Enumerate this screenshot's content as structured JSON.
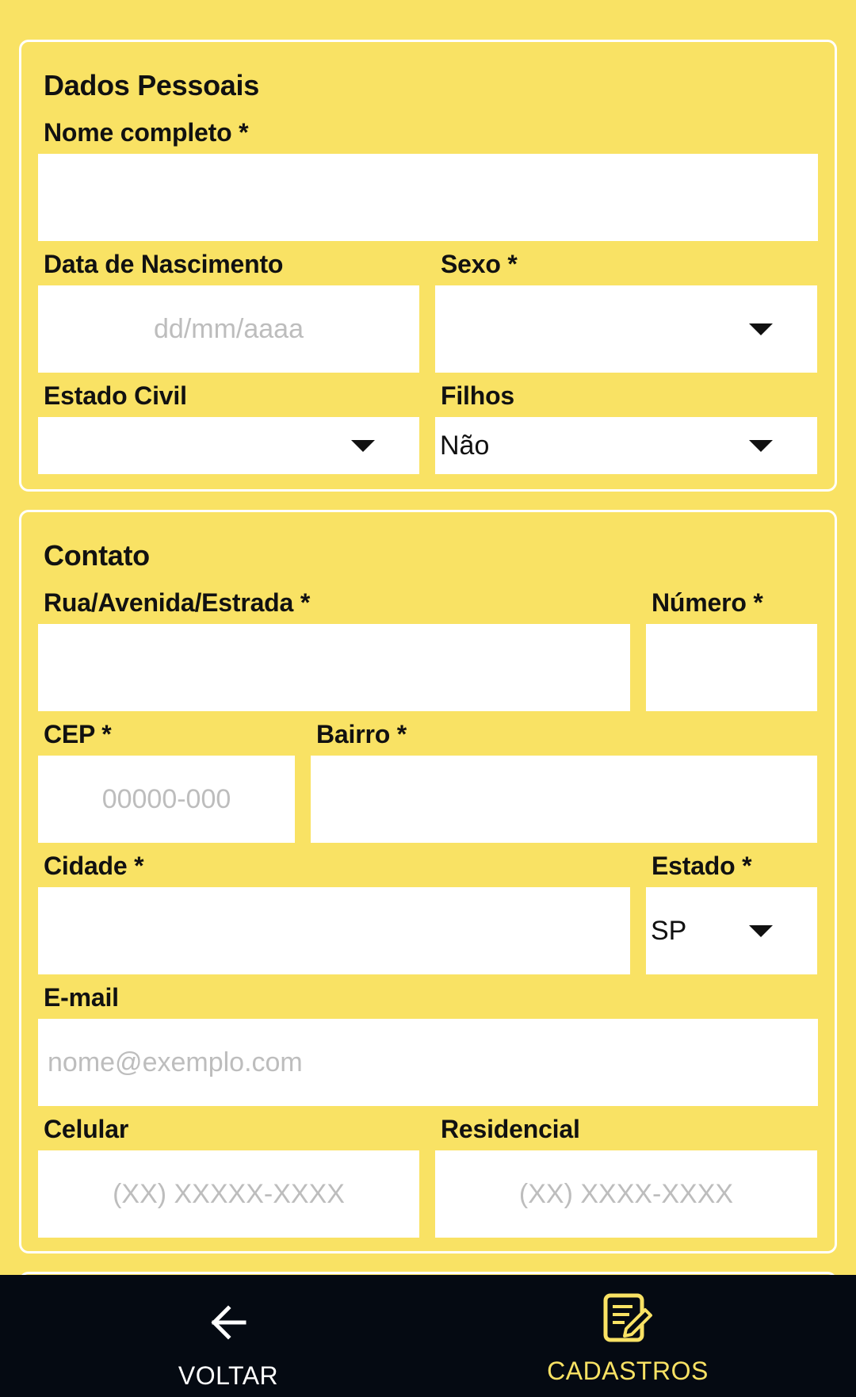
{
  "personal": {
    "title": "Dados Pessoais",
    "full_name_label": "Nome completo *",
    "birth_label": "Data de Nascimento",
    "birth_placeholder": "dd/mm/aaaa",
    "sex_label": "Sexo *",
    "sex_value": "",
    "marital_label": "Estado Civil",
    "marital_value": "",
    "children_label": "Filhos",
    "children_value": "Não"
  },
  "contact": {
    "title": "Contato",
    "street_label": "Rua/Avenida/Estrada *",
    "number_label": "Número *",
    "cep_label": "CEP *",
    "cep_placeholder": "00000-000",
    "district_label": "Bairro *",
    "city_label": "Cidade *",
    "state_label": "Estado *",
    "state_value": "SP",
    "email_label": "E-mail",
    "email_placeholder": "nome@exemplo.com",
    "mobile_label": "Celular",
    "mobile_placeholder": "(XX) XXXXX-XXXX",
    "home_label": "Residencial",
    "home_placeholder": "(XX) XXXX-XXXX"
  },
  "bottom_nav": {
    "back_label": "VOLTAR",
    "back_icon": "arrow-left-icon",
    "registrations_label": "CADASTROS",
    "registrations_icon": "edit-document-icon",
    "active_color": "#f9e264",
    "bar_color": "#050a12"
  },
  "colors": {
    "background": "#f9e264",
    "field": "#ffffff",
    "placeholder": "#bdbdbd"
  }
}
